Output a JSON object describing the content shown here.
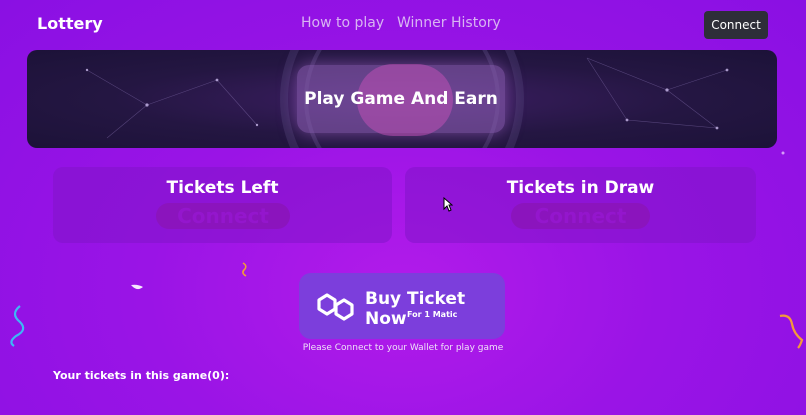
{
  "navbar": {
    "brand": "Lottery",
    "links": [
      "How to play",
      "Winner History"
    ],
    "connect_label": "Connect"
  },
  "banner": {
    "title": "Play Game And Earn"
  },
  "stats": [
    {
      "title": "Tickets Left",
      "value": "Connect"
    },
    {
      "title": "Tickets in Draw",
      "value": "Connect"
    }
  ],
  "buy": {
    "label": "Buy Ticket Now",
    "sublabel": "For 1 Matic",
    "icon": "polygon-matic-icon"
  },
  "wallet_note": "Please Connect to your Wallet for play game",
  "your_tickets_label": "Your tickets in this game(0):",
  "colors": {
    "background": "#9a14e6",
    "banner": "#241642",
    "buy_button": "#7c3edc",
    "connect_button": "#2e2e38",
    "card": "#8214c8"
  }
}
